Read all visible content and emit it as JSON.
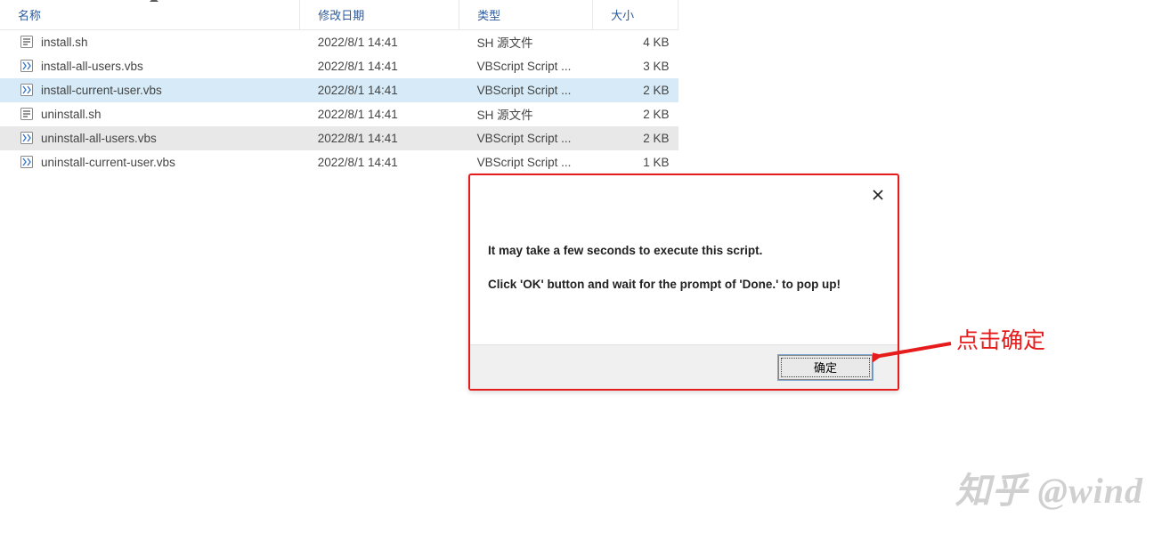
{
  "columns": {
    "name": "名称",
    "date": "修改日期",
    "type": "类型",
    "size": "大小"
  },
  "files": [
    {
      "name": "install.sh",
      "date": "2022/8/1 14:41",
      "type": "SH 源文件",
      "size": "4 KB",
      "icon": "sh",
      "state": ""
    },
    {
      "name": "install-all-users.vbs",
      "date": "2022/8/1 14:41",
      "type": "VBScript Script ...",
      "size": "3 KB",
      "icon": "vbs",
      "state": ""
    },
    {
      "name": "install-current-user.vbs",
      "date": "2022/8/1 14:41",
      "type": "VBScript Script ...",
      "size": "2 KB",
      "icon": "vbs",
      "state": "selected"
    },
    {
      "name": "uninstall.sh",
      "date": "2022/8/1 14:41",
      "type": "SH 源文件",
      "size": "2 KB",
      "icon": "sh",
      "state": ""
    },
    {
      "name": "uninstall-all-users.vbs",
      "date": "2022/8/1 14:41",
      "type": "VBScript Script ...",
      "size": "2 KB",
      "icon": "vbs",
      "state": "hovered"
    },
    {
      "name": "uninstall-current-user.vbs",
      "date": "2022/8/1 14:41",
      "type": "VBScript Script ...",
      "size": "1 KB",
      "icon": "vbs",
      "state": ""
    }
  ],
  "dialog": {
    "line1": "It may take a few seconds to execute this script.",
    "line2": "Click 'OK' button and wait for the prompt of 'Done.' to pop up!",
    "ok": "确定"
  },
  "annotation": "点击确定",
  "watermark": "知乎 @wind"
}
